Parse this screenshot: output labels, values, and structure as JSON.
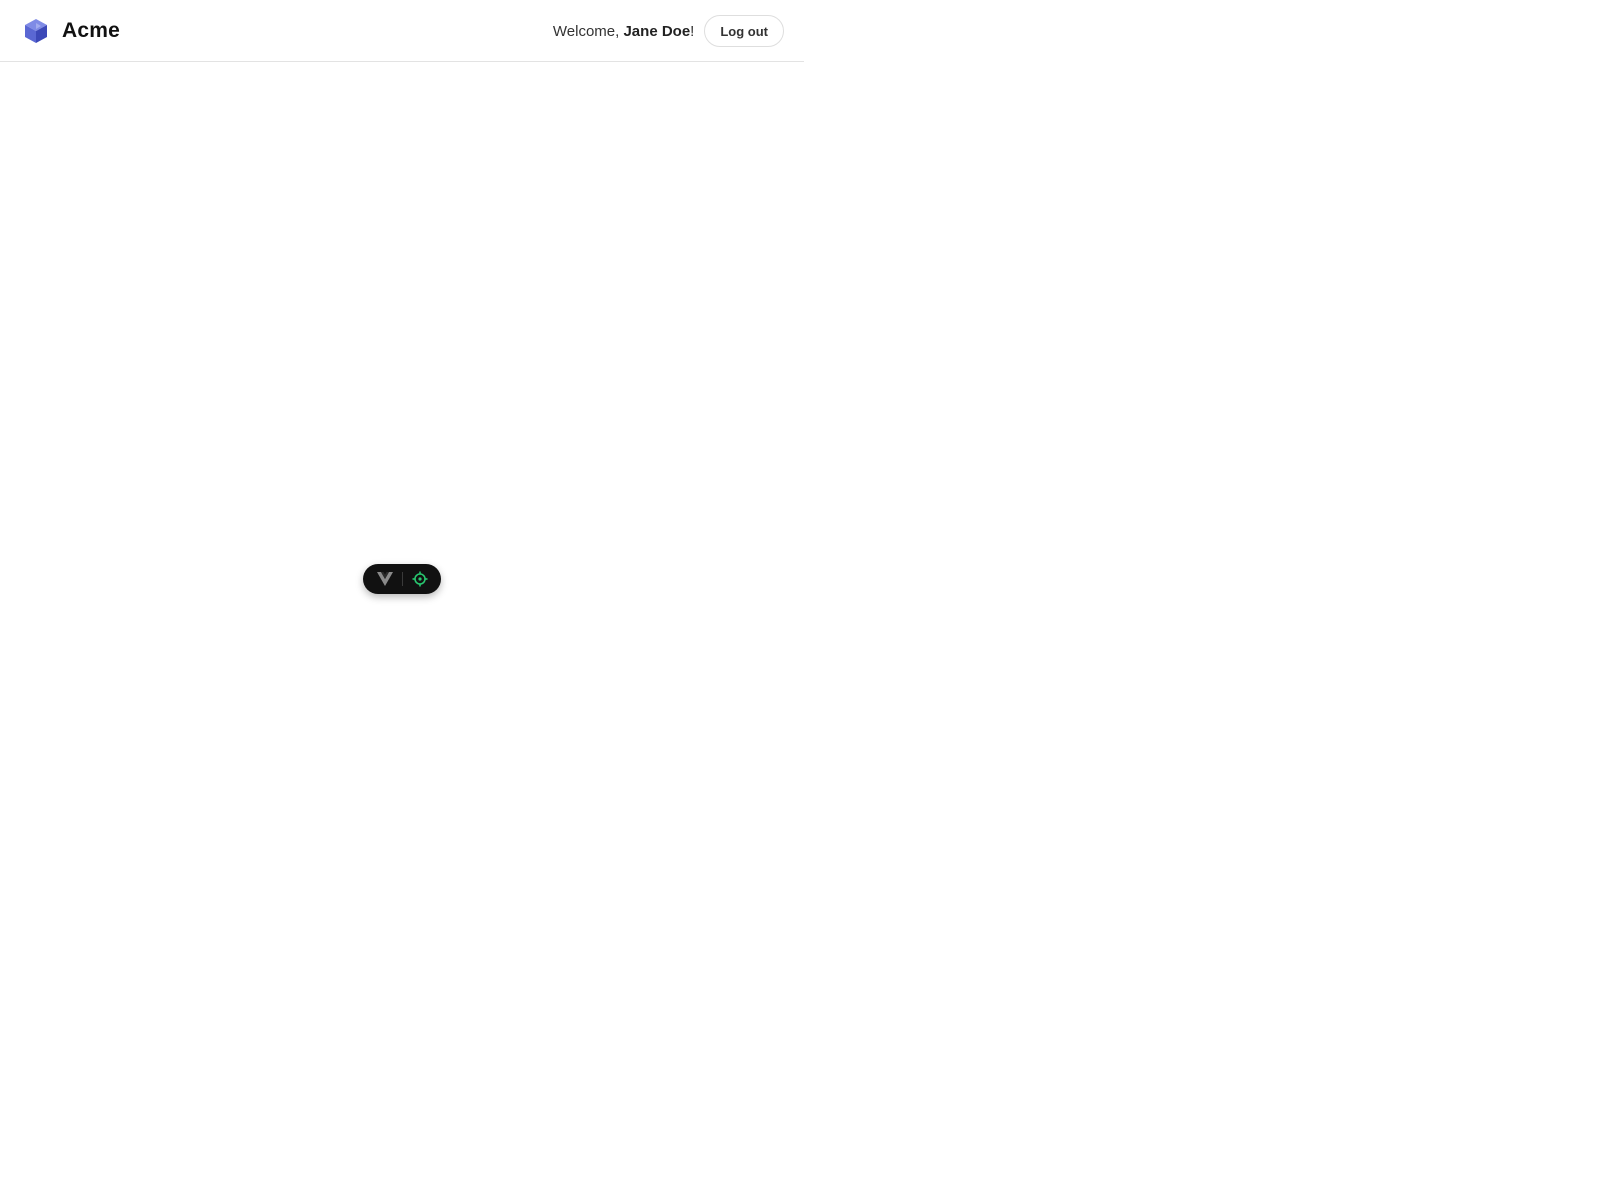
{
  "header": {
    "brand": {
      "name": "Acme",
      "logo_icon": "cube-logo-icon"
    },
    "user": {
      "welcome_prefix": "Welcome, ",
      "user_name": "Jane Doe",
      "welcome_suffix": "!"
    },
    "logout_label": "Log out"
  },
  "devtools": {
    "toggle_icon": "vue-logo-icon",
    "inspect_icon": "crosshair-icon"
  },
  "colors": {
    "logo_dark": "#4f5bc8",
    "logo_light": "#9aa4ec",
    "inspect_accent": "#28c76f",
    "devtools_bg": "#111111"
  }
}
